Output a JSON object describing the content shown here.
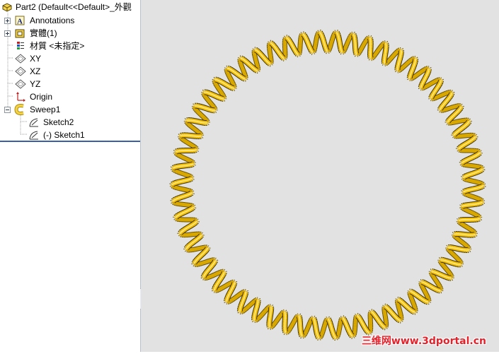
{
  "tree": {
    "part": "Part2  (Default<<Default>_外觀",
    "items": [
      {
        "label": "Annotations",
        "icon": "annotations-icon"
      },
      {
        "label": "實體(1)",
        "icon": "solid-bodies-icon"
      },
      {
        "label": "材質 <未指定>",
        "icon": "material-icon"
      },
      {
        "label": "XY",
        "icon": "plane-icon"
      },
      {
        "label": "XZ",
        "icon": "plane-icon"
      },
      {
        "label": "YZ",
        "icon": "plane-icon"
      },
      {
        "label": "Origin",
        "icon": "origin-icon"
      },
      {
        "label": "Sweep1",
        "icon": "sweep-icon"
      },
      {
        "label": "Sketch2",
        "icon": "sketch-icon"
      },
      {
        "label": "(-) Sketch1",
        "icon": "sketch-icon"
      }
    ]
  },
  "viewport": {
    "model": "helical-spring-ring",
    "coil_color": "#f4c000",
    "background": "#e2e2e2"
  },
  "watermark": "三维网www.3dportal.cn"
}
